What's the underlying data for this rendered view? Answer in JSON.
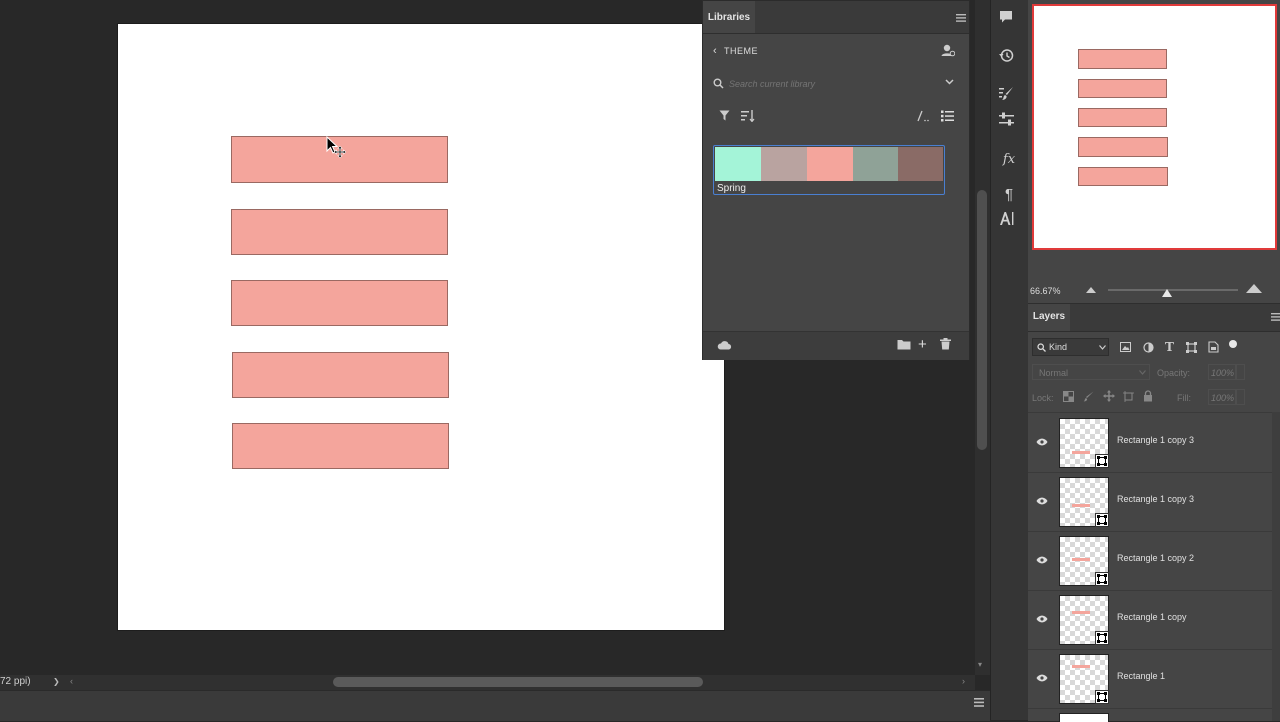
{
  "status": {
    "ppi_text": "72 ppi)",
    "arrow": "❯"
  },
  "libraries": {
    "tab_label": "Libraries",
    "back_label": "THEME",
    "search_placeholder": "Search current library",
    "theme_name": "Spring",
    "swatches": [
      "#a4f4d8",
      "#b9a3a0",
      "#f4a59c",
      "#8fa297",
      "#8a6b66"
    ]
  },
  "navigator": {
    "zoom": "66.67%"
  },
  "layers": {
    "tab_label": "Layers",
    "filter_kind": "Kind",
    "blend_mode": "Normal",
    "opacity_label": "Opacity:",
    "opacity_value": "100%",
    "lock_label": "Lock:",
    "fill_label": "Fill:",
    "fill_value": "100%",
    "items": [
      {
        "name": "Rectangle 1 copy 3",
        "bar_top": 0.67
      },
      {
        "name": "Rectangle 1 copy 3",
        "bar_top": 0.55
      },
      {
        "name": "Rectangle 1 copy 2",
        "bar_top": 0.43
      },
      {
        "name": "Rectangle 1 copy",
        "bar_top": 0.31
      },
      {
        "name": "Rectangle 1",
        "bar_top": 0.2
      }
    ]
  },
  "colors": {
    "shape_fill": "#f4a59c",
    "navigator_border": "#e03a3a",
    "selection_outline": "#4a7fd1"
  }
}
